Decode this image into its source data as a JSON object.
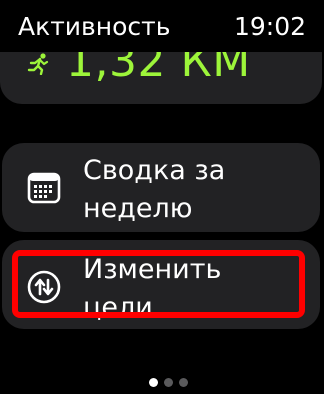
{
  "status_bar": {
    "app_title": "Активность",
    "time": "19:02"
  },
  "distance_card": {
    "value": "1,32 КМ",
    "icon": "running-figure-icon",
    "accent_color": "#9df53a"
  },
  "menu": {
    "items": [
      {
        "label_line1": "Сводка за",
        "label_line2": "неделю",
        "icon": "calendar-icon"
      },
      {
        "label_line1": "Изменить",
        "label_line2": "цели",
        "icon": "change-goals-icon"
      }
    ]
  },
  "highlight": {
    "color": "#ff0000",
    "target": "change-goals"
  },
  "pagination": {
    "total": 3,
    "current": 1
  }
}
